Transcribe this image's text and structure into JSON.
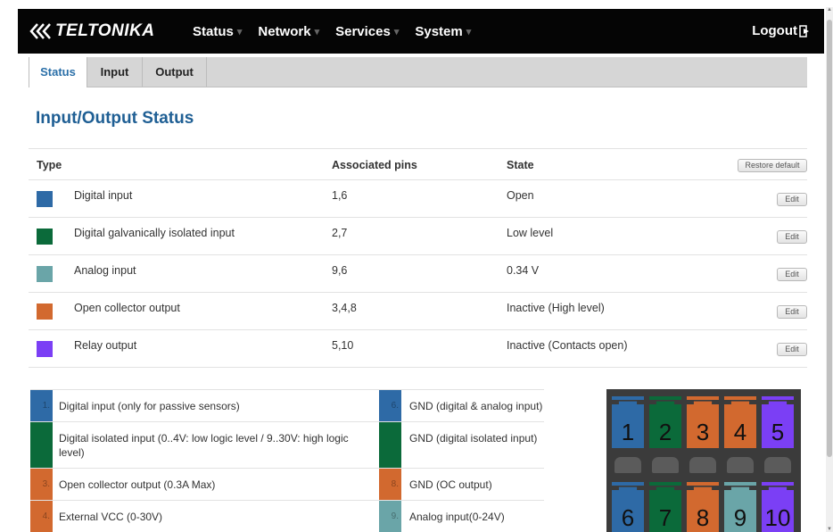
{
  "navbar": {
    "logo": "TELTONIKA",
    "menu": [
      {
        "label": "Status"
      },
      {
        "label": "Network"
      },
      {
        "label": "Services"
      },
      {
        "label": "System"
      }
    ],
    "logout": "Logout"
  },
  "tabs": [
    {
      "label": "Status",
      "active": true
    },
    {
      "label": "Input",
      "active": false
    },
    {
      "label": "Output",
      "active": false
    }
  ],
  "page_title": "Input/Output Status",
  "table": {
    "headers": {
      "type": "Type",
      "pins": "Associated pins",
      "state": "State"
    },
    "restore_label": "Restore default",
    "edit_label": "Edit",
    "rows": [
      {
        "type": "Digital input",
        "pins": "1,6",
        "state": "Open",
        "color": "#2e6aa6"
      },
      {
        "type": "Digital galvanically isolated input",
        "pins": "2,7",
        "state": "Low level",
        "color": "#0b6a3a"
      },
      {
        "type": "Analog input",
        "pins": "9,6",
        "state": "0.34 V",
        "color": "#6aa5a8"
      },
      {
        "type": "Open collector output",
        "pins": "3,4,8",
        "state": "Inactive (High level)",
        "color": "#d2692f"
      },
      {
        "type": "Relay output",
        "pins": "5,10",
        "state": "Inactive (Contacts open)",
        "color": "#7b3ff5"
      }
    ]
  },
  "legend": {
    "rows": [
      {
        "left_num": "1.",
        "left_text": "Digital input (only for passive sensors)",
        "left_color": "#2e6aa6",
        "right_num": "6.",
        "right_text": "GND (digital & analog input)",
        "right_color": "#2e6aa6"
      },
      {
        "left_num": "2.",
        "left_text": "Digital isolated input (0..4V: low logic level / 9..30V: high logic level)",
        "left_color": "#0b6a3a",
        "right_num": "7.",
        "right_text": "GND (digital isolated input)",
        "right_color": "#0b6a3a"
      },
      {
        "left_num": "3.",
        "left_text": "Open collector output (0.3A Max)",
        "left_color": "#d2692f",
        "right_num": "8.",
        "right_text": "GND (OC output)",
        "right_color": "#d2692f"
      },
      {
        "left_num": "4.",
        "left_text": "External VCC (0-30V)",
        "left_color": "#d2692f",
        "right_num": "9.",
        "right_text": "Analog input(0-24V)",
        "right_color": "#6aa5a8"
      }
    ]
  },
  "connector": {
    "top_pins": [
      {
        "label": "1",
        "color": "#2e6aa6"
      },
      {
        "label": "2",
        "color": "#0b6a3a"
      },
      {
        "label": "3",
        "color": "#d2692f"
      },
      {
        "label": "4",
        "color": "#d2692f"
      },
      {
        "label": "5",
        "color": "#7b3ff5"
      }
    ],
    "bottom_pins": [
      {
        "label": "6",
        "color": "#2e6aa6"
      },
      {
        "label": "7",
        "color": "#0b6a3a"
      },
      {
        "label": "8",
        "color": "#d2692f"
      },
      {
        "label": "9",
        "color": "#6aa5a8"
      },
      {
        "label": "10",
        "color": "#7b3ff5"
      }
    ]
  }
}
